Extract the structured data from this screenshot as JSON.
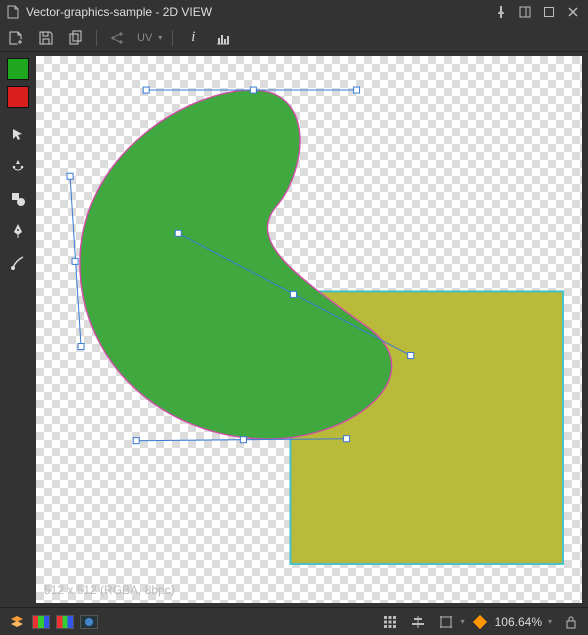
{
  "title": "Vector-graphics-sample - 2D VIEW",
  "toolbar": {
    "uv_label": "UV"
  },
  "colors": {
    "accent": "#2f88d0",
    "handle": "#3a7bd5",
    "bean_fill": "#3fa83f",
    "bean_stroke": "#d24da8",
    "rect_fill": "#b9b93a",
    "rect_stroke": "#46c0c9",
    "rect_olive": "#b0a83c"
  },
  "swatches": [
    {
      "name": "swatch-green",
      "color": "#1fa81f"
    },
    {
      "name": "swatch-red",
      "color": "#d91e1e"
    }
  ],
  "canvas": {
    "dim_label": "512 x 512 (RGBA, 8bpc)"
  },
  "status": {
    "zoom": "106.64%"
  }
}
